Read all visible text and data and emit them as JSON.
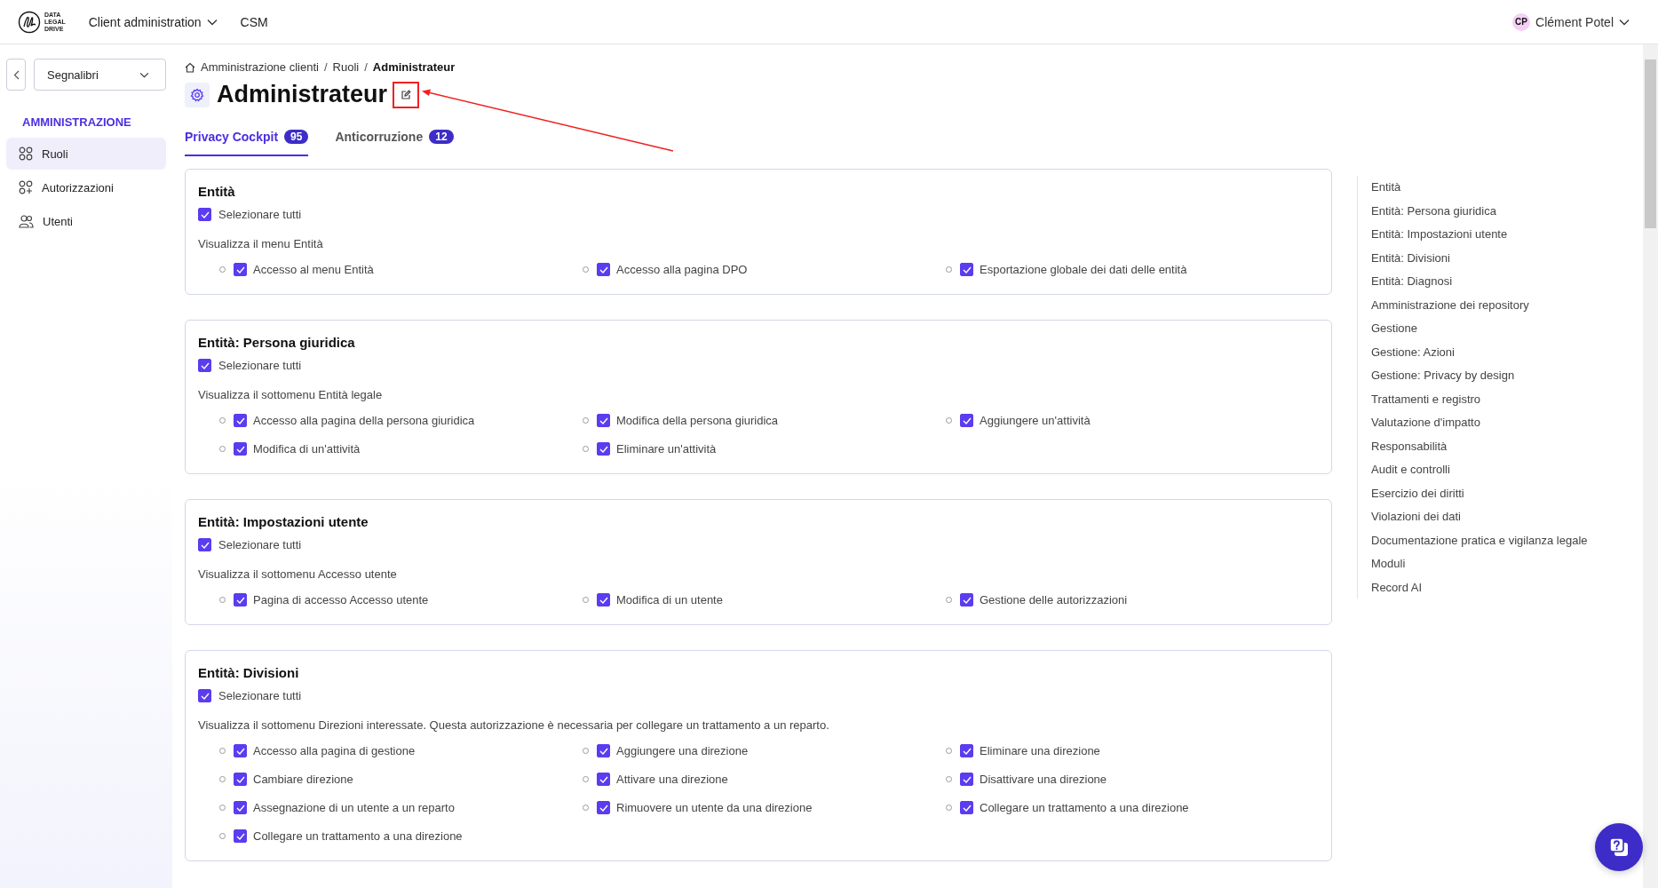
{
  "header": {
    "logo_lines": [
      "DATA",
      "LEGAL",
      "DRIVE"
    ],
    "nav": [
      {
        "label": "Client administration",
        "dropdown": true
      },
      {
        "label": "CSM",
        "dropdown": false
      }
    ],
    "user": {
      "initials": "CP",
      "name": "Clément Potel"
    }
  },
  "sidebar": {
    "bookmarks": "Segnalibri",
    "section": "AMMINISTRAZIONE",
    "items": [
      {
        "label": "Ruoli",
        "kind": "grid",
        "selected": true
      },
      {
        "label": "Autorizzazioni",
        "kind": "grid-plus",
        "selected": false
      },
      {
        "label": "Utenti",
        "kind": "users",
        "selected": false
      }
    ]
  },
  "breadcrumb": [
    "Amministrazione clienti",
    "Ruoli",
    "Administrateur"
  ],
  "breadcrumb_separator": "/",
  "title": "Administrateur",
  "tabs": [
    {
      "label": "Privacy Cockpit",
      "count": "95",
      "selected": true
    },
    {
      "label": "Anticorruzione",
      "count": "12",
      "selected": false
    }
  ],
  "sections": [
    {
      "title": "Entità",
      "select_all": {
        "label": "Selezionare tutti",
        "checked": true
      },
      "description": "Visualizza il menu Entità",
      "permissions": [
        {
          "label": "Accesso al menu Entità",
          "checked": true
        },
        {
          "label": "Accesso alla pagina DPO",
          "checked": true
        },
        {
          "label": "Esportazione globale dei dati delle entità",
          "checked": true
        }
      ]
    },
    {
      "title": "Entità: Persona giuridica",
      "select_all": {
        "label": "Selezionare tutti",
        "checked": true
      },
      "description": "Visualizza il sottomenu Entità legale",
      "permissions": [
        {
          "label": "Accesso alla pagina della persona giuridica",
          "checked": true
        },
        {
          "label": "Modifica della persona giuridica",
          "checked": true
        },
        {
          "label": "Aggiungere un'attività",
          "checked": true
        },
        {
          "label": "Modifica di un'attività",
          "checked": true
        },
        {
          "label": "Eliminare un'attività",
          "checked": true
        }
      ]
    },
    {
      "title": "Entità: Impostazioni utente",
      "select_all": {
        "label": "Selezionare tutti",
        "checked": true
      },
      "description": "Visualizza il sottomenu Accesso utente",
      "permissions": [
        {
          "label": "Pagina di accesso Accesso utente",
          "checked": true
        },
        {
          "label": "Modifica di un utente",
          "checked": true
        },
        {
          "label": "Gestione delle autorizzazioni",
          "checked": true
        }
      ]
    },
    {
      "title": "Entità: Divisioni",
      "select_all": {
        "label": "Selezionare tutti",
        "checked": true
      },
      "description": "Visualizza il sottomenu Direzioni interessate. Questa autorizzazione è necessaria per collegare un trattamento a un reparto.",
      "permissions": [
        {
          "label": "Accesso alla pagina di gestione",
          "checked": true
        },
        {
          "label": "Aggiungere una direzione",
          "checked": true
        },
        {
          "label": "Eliminare una direzione",
          "checked": true
        },
        {
          "label": "Cambiare direzione",
          "checked": true
        },
        {
          "label": "Attivare una direzione",
          "checked": true
        },
        {
          "label": "Disattivare una direzione",
          "checked": true
        },
        {
          "label": "Assegnazione di un utente a un reparto",
          "checked": true
        },
        {
          "label": "Rimuovere un utente da una direzione",
          "checked": true
        },
        {
          "label": "Collegare un trattamento a una direzione",
          "checked": true
        },
        {
          "label": "Collegare un trattamento a una direzione",
          "checked": true
        }
      ]
    }
  ],
  "toc": [
    "Entità",
    "Entità: Persona giuridica",
    "Entità: Impostazioni utente",
    "Entità: Divisioni",
    "Entità: Diagnosi",
    "Amministrazione dei repository",
    "Gestione",
    "Gestione: Azioni",
    "Gestione: Privacy by design",
    "Trattamenti e registro",
    "Valutazione d'impatto",
    "Responsabilità",
    "Audit e controlli",
    "Esercizio dei diritti",
    "Violazioni dei dati",
    "Documentazione pratica e vigilanza legale",
    "Moduli",
    "Record AI"
  ]
}
